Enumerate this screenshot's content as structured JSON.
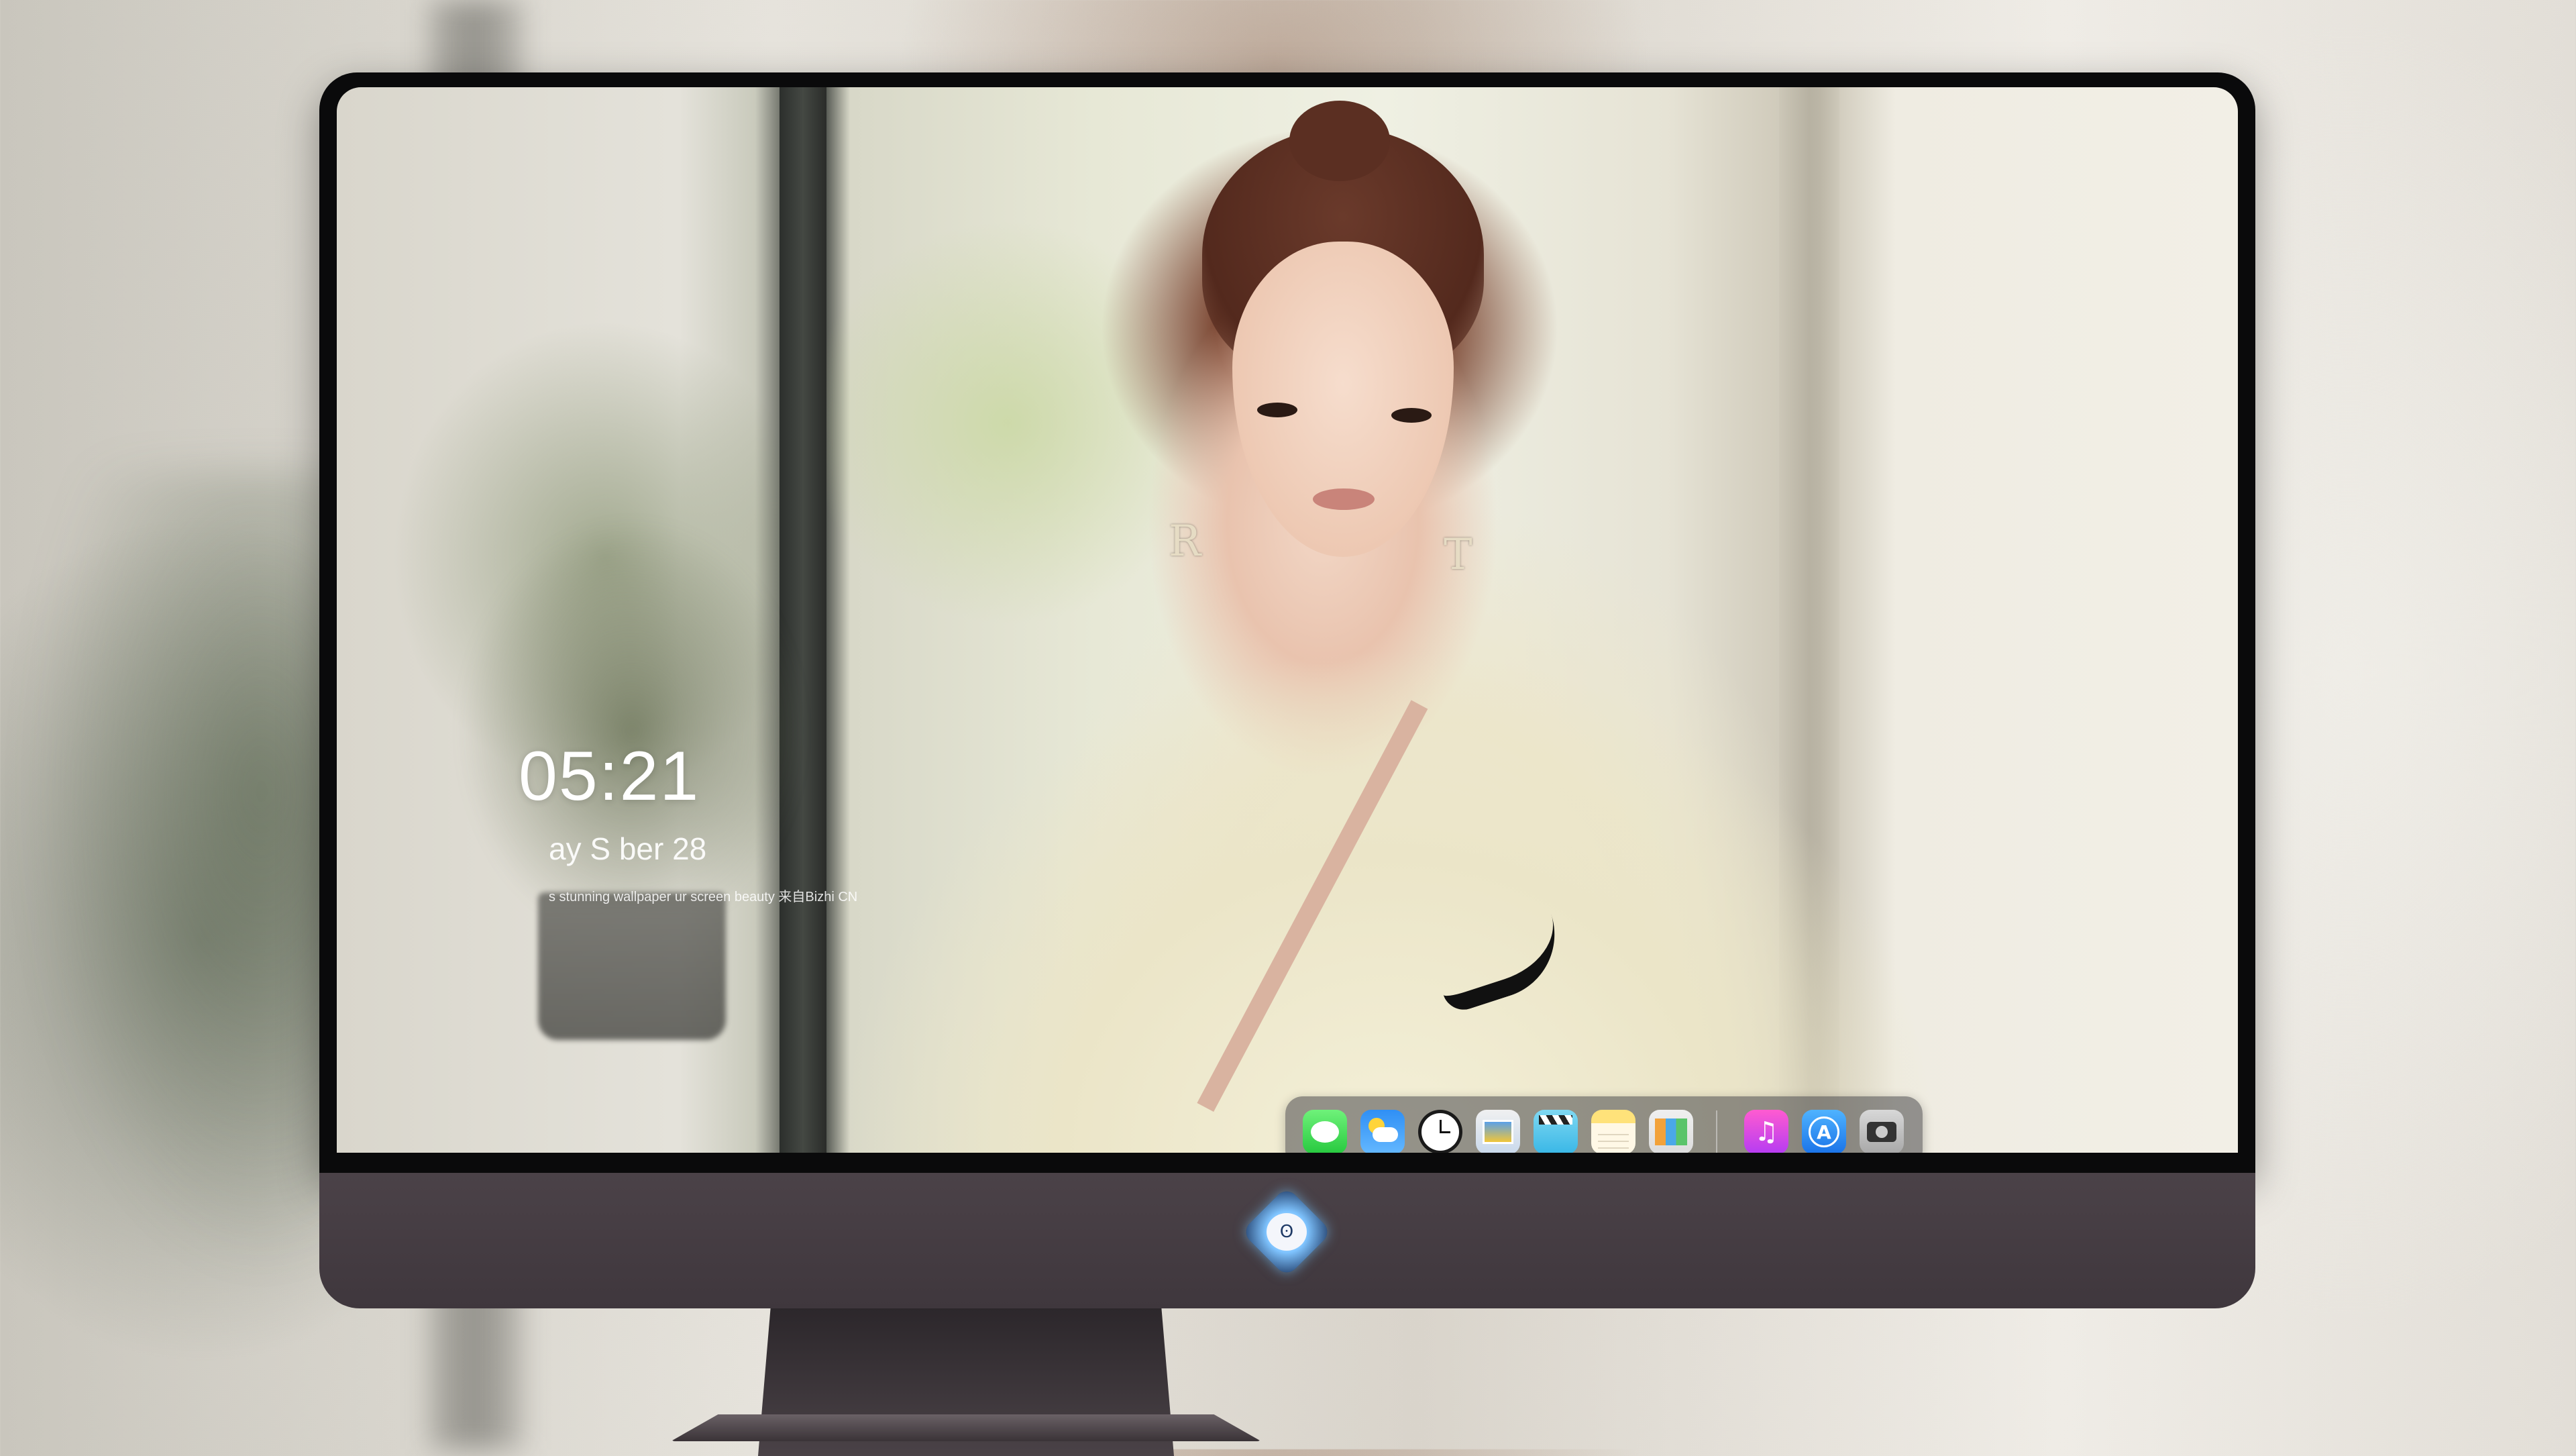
{
  "lockscreen": {
    "time": "05:21",
    "date": "ay S        ber  28",
    "tagline": "s stunning wallpaper          ur screen beauty  来自Bizhi CN"
  },
  "dock": {
    "items": [
      {
        "name": "messages-icon"
      },
      {
        "name": "weather-icon"
      },
      {
        "name": "clock-icon"
      },
      {
        "name": "preview-icon"
      },
      {
        "name": "clapper-icon"
      },
      {
        "name": "notes-icon"
      },
      {
        "name": "photos-icon"
      },
      {
        "name": "music-icon",
        "glyph": "♫"
      },
      {
        "name": "app-store-icon",
        "glyph": "A"
      },
      {
        "name": "camera-icon"
      }
    ]
  },
  "wallpaper": {
    "earring_left": "R",
    "earring_right": "T"
  },
  "logo": {
    "glyph": "ʘ"
  }
}
